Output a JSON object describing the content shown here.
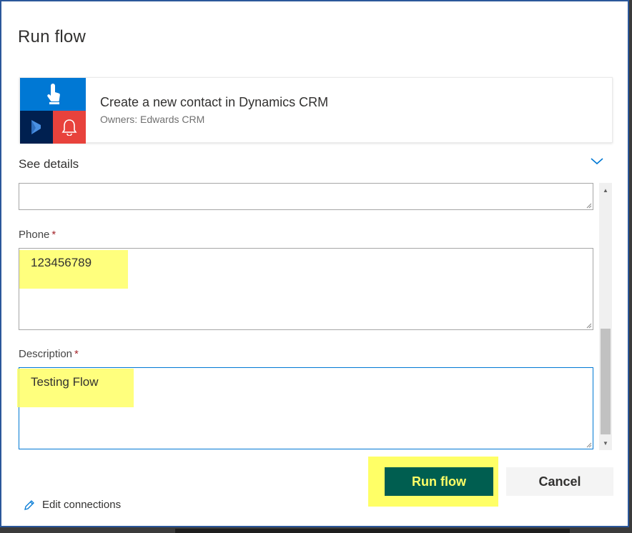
{
  "dialog": {
    "title": "Run flow"
  },
  "flow_card": {
    "name": "Create a new contact in Dynamics CRM",
    "owners": "Owners: Edwards CRM",
    "icons": [
      "touch-icon",
      "dynamics-icon",
      "bell-icon"
    ]
  },
  "details": {
    "label": "See details"
  },
  "form": {
    "phone": {
      "label": "Phone",
      "required_mark": "*",
      "value": "123456789"
    },
    "description": {
      "label": "Description",
      "required_mark": "*",
      "value": "Testing Flow"
    }
  },
  "actions": {
    "run_label": "Run flow",
    "cancel_label": "Cancel",
    "edit_connections_label": "Edit connections"
  },
  "colors": {
    "accent": "#0078d4",
    "run_button": "#005e50",
    "highlight": "#ffff66",
    "required": "#a4262c"
  }
}
